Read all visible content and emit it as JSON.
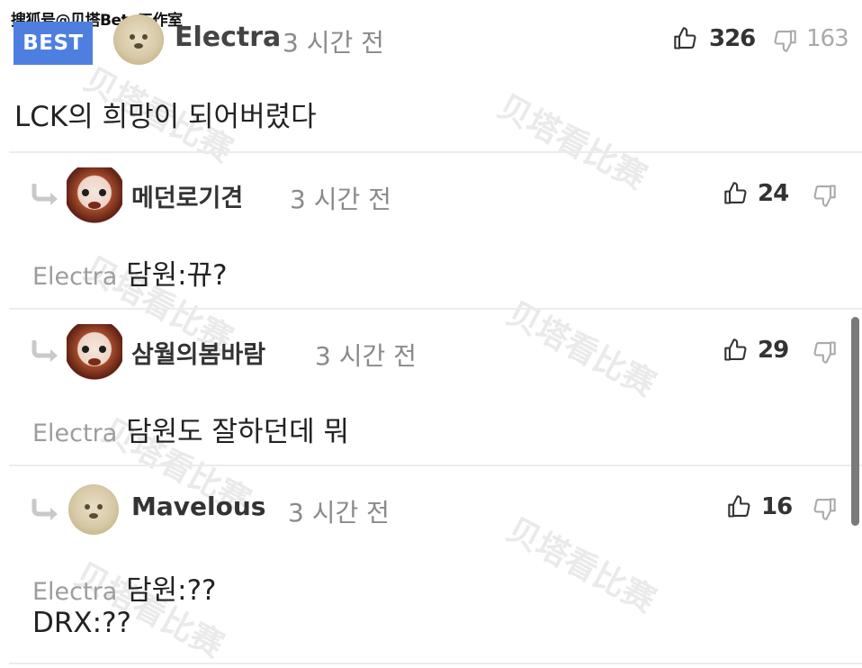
{
  "credit": "搜狐号@贝塔Beta工作室",
  "watermark_text": "贝塔看比赛",
  "top_comment": {
    "badge": "BEST",
    "author": "Electra",
    "time": "3 시간 전",
    "likes": "326",
    "dislikes": "163",
    "text": "LCK의 희망이 되어버렸다"
  },
  "replies": [
    {
      "author": "메던로기견",
      "time": "3 시간 전",
      "likes": "24",
      "mention": "Electra",
      "text": "담원:뀨?"
    },
    {
      "author": "삼월의봄바람",
      "time": "3 시간 전",
      "likes": "29",
      "mention": "Electra",
      "text": "담원도 잘하던데 뭐"
    },
    {
      "author": "Mavelous",
      "time": "3 시간 전",
      "likes": "16",
      "mention": "Electra",
      "text": "담원:??",
      "text_line2": "DRX:??"
    }
  ],
  "icons": {
    "like": "thumbs-up-icon",
    "dislike": "thumbs-down-icon",
    "reply": "reply-arrow-icon"
  },
  "colors": {
    "best_badge": "#4e7fe0",
    "muted_text": "#9d9d9d"
  }
}
